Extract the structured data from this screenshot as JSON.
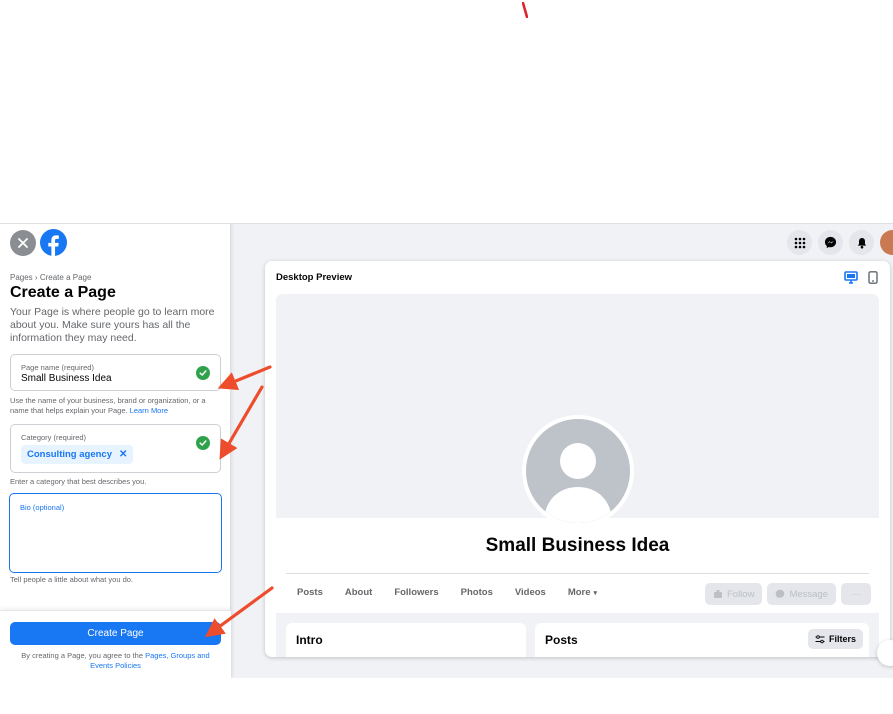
{
  "breadcrumb": {
    "pages": "Pages",
    "separator": "›",
    "current": "Create a Page"
  },
  "title": "Create a Page",
  "intro": "Your Page is where people go to learn more about you. Make sure yours has all the information they may need.",
  "page_name": {
    "label": "Page name (required)",
    "value": "Small Business Idea",
    "hint": "Use the name of your business, brand or organization, or a name that helps explain your Page.",
    "hint_link": "Learn More"
  },
  "category": {
    "label": "Category (required)",
    "chip": "Consulting agency",
    "chip_remove": "✕",
    "hint": "Enter a category that best describes you."
  },
  "bio": {
    "label": "Bio (optional)",
    "hint": "Tell people a little about what you do."
  },
  "footer": {
    "create_button": "Create Page",
    "terms_prefix": "By creating a Page, you agree to the",
    "terms_link": "Pages, Groups and Events Policies"
  },
  "preview": {
    "title": "Desktop Preview",
    "page_name": "Small Business Idea",
    "tabs": [
      "Posts",
      "About",
      "Followers",
      "Photos",
      "Videos",
      "More"
    ],
    "more_caret": "▾",
    "follow": "Follow",
    "message": "Message",
    "more_actions": "···",
    "intro_heading": "Intro",
    "posts_heading": "Posts",
    "filters": "Filters"
  },
  "colors": {
    "brand_blue": "#1877f2",
    "success_green": "#31a24c",
    "annotation_red": "#ee4d2d"
  },
  "icons": [
    "close-icon",
    "facebook-logo-icon",
    "grid-menu-icon",
    "messenger-icon",
    "bell-icon",
    "desktop-icon",
    "mobile-icon",
    "checkmark-icon"
  ]
}
